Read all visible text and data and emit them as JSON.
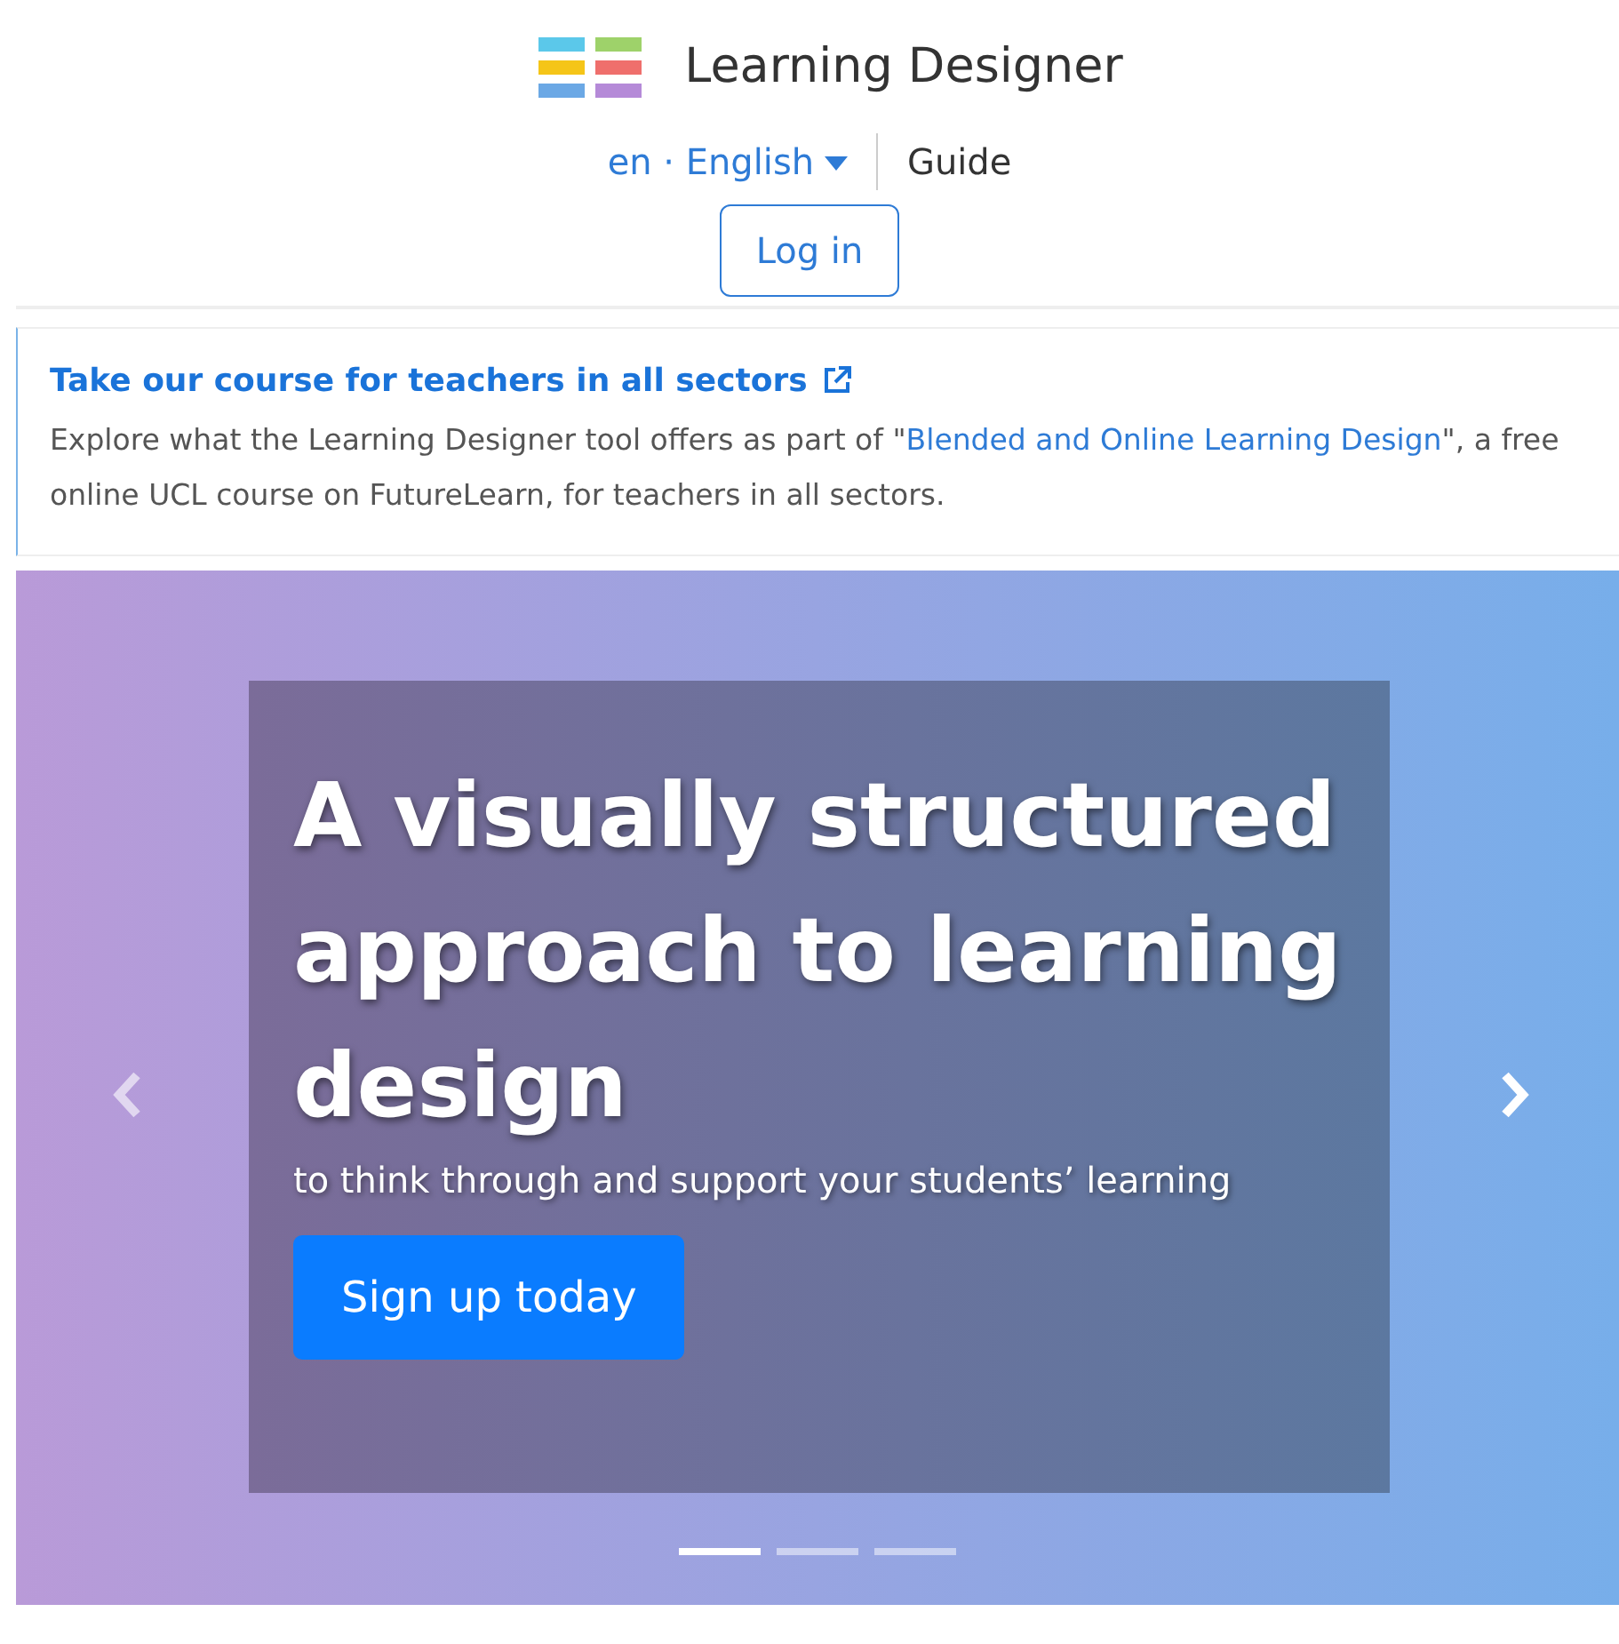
{
  "header": {
    "title": "Learning Designer",
    "language": "en · English",
    "guide": "Guide",
    "login": "Log in"
  },
  "promo": {
    "title": "Take our course for teachers in all sectors",
    "text_before": "Explore what the Learning Designer tool offers as part of \"",
    "link": "Blended and Online Learning Design",
    "text_after": "\", a free online UCL course on FutureLearn, for teachers in all sectors."
  },
  "carousel": {
    "heading": "A visually structured approach to learning design",
    "subheading": "to think through and support your students’ learning",
    "button": "Sign up today",
    "indicators": [
      {
        "selected": true
      },
      {
        "selected": false
      },
      {
        "selected": false
      }
    ]
  }
}
